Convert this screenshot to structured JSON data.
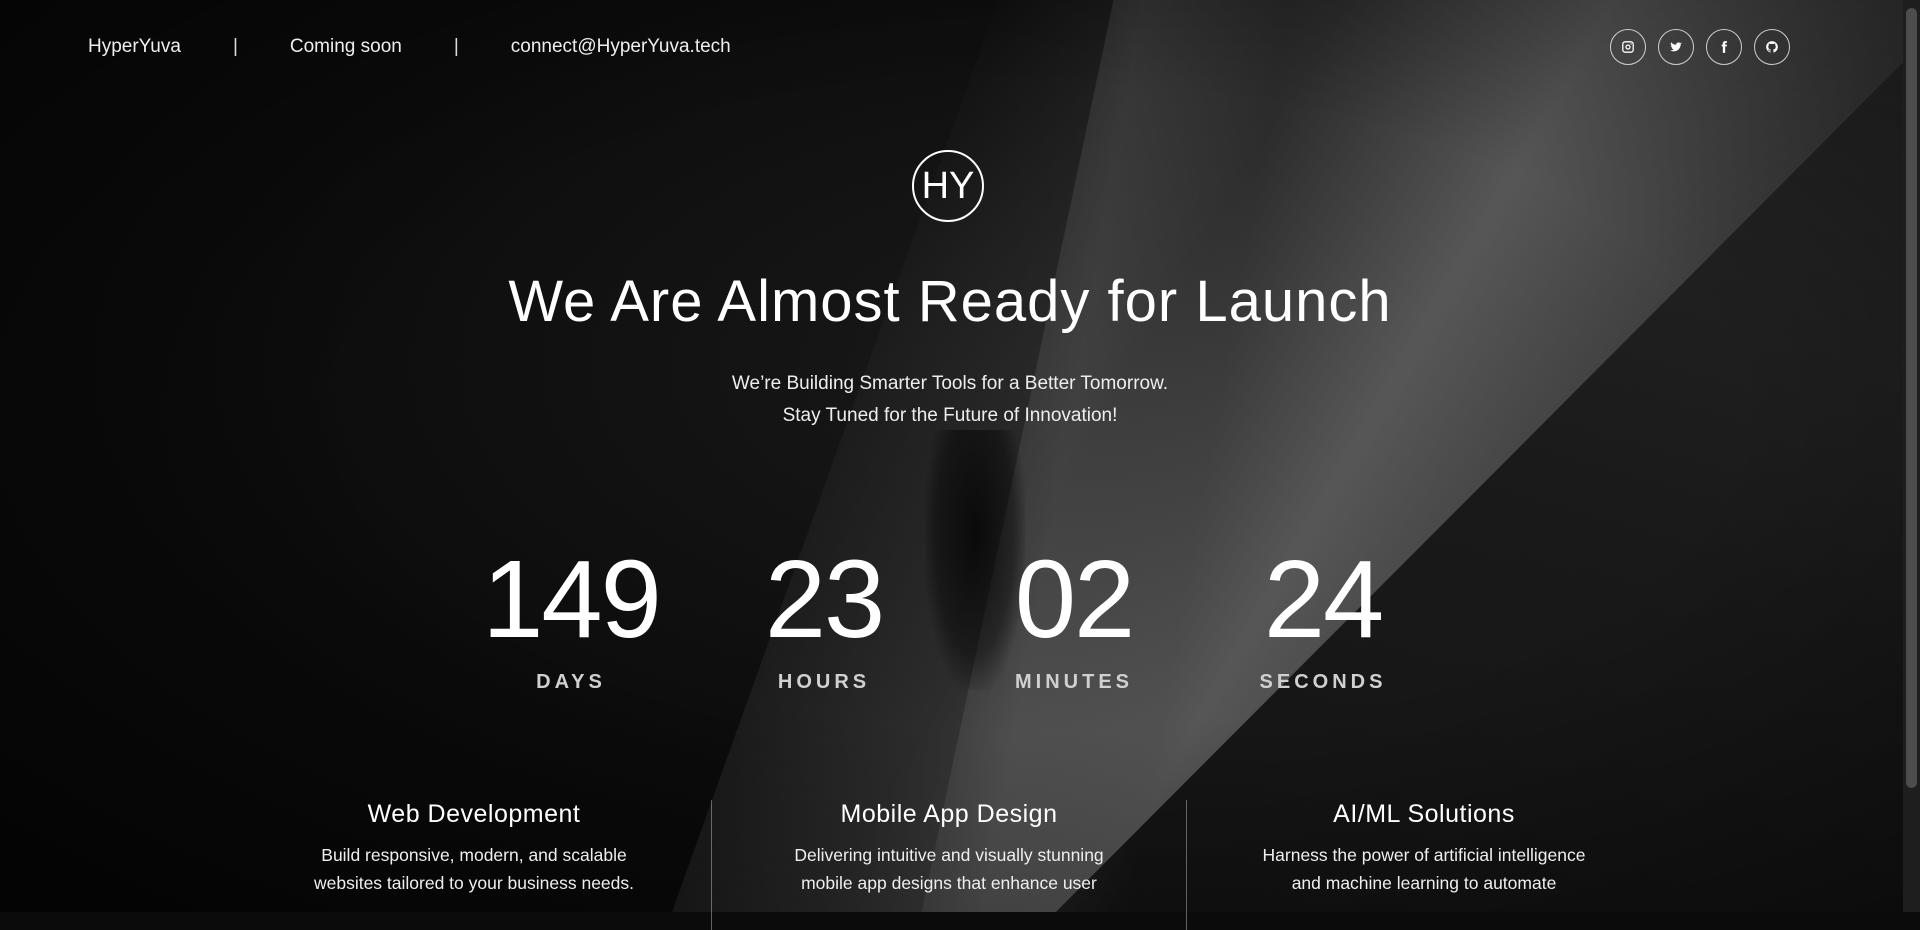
{
  "header": {
    "brand": "HyperYuva",
    "separator": "|",
    "status": "Coming soon",
    "email": "connect@HyperYuva.tech",
    "social": [
      {
        "icon": "instagram-icon"
      },
      {
        "icon": "twitter-icon"
      },
      {
        "icon": "facebook-icon"
      },
      {
        "icon": "github-icon"
      }
    ]
  },
  "hero": {
    "logo_text": "HY",
    "title": "We Are Almost Ready for Launch",
    "subtitle_line1": "We’re Building Smarter Tools for a Better Tomorrow.",
    "subtitle_line2": "Stay Tuned for the Future of Innovation!"
  },
  "countdown": {
    "days": {
      "value": "149",
      "label": "DAYS"
    },
    "hours": {
      "value": "23",
      "label": "HOURS"
    },
    "minutes": {
      "value": "02",
      "label": "MINUTES"
    },
    "seconds": {
      "value": "24",
      "label": "SECONDS"
    }
  },
  "services": [
    {
      "title": "Web Development",
      "line1": "Build responsive, modern, and scalable",
      "line2": "websites tailored to your business needs."
    },
    {
      "title": "Mobile App Design",
      "line1": "Delivering intuitive and visually stunning",
      "line2": "mobile app designs that enhance user"
    },
    {
      "title": "AI/ML Solutions",
      "line1": "Harness the power of artificial intelligence",
      "line2": "and machine learning to automate"
    }
  ],
  "colors": {
    "background": "#0b0b0b",
    "text": "#ffffff",
    "label": "#d0d0d0"
  }
}
